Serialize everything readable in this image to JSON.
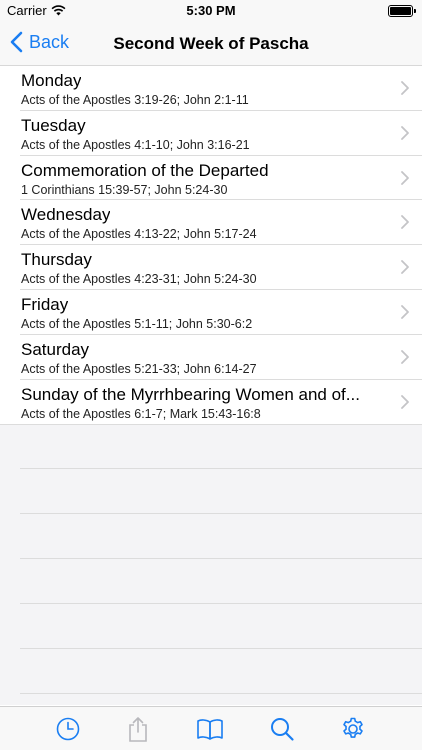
{
  "status_bar": {
    "carrier": "Carrier",
    "time": "5:30 PM",
    "wifi_icon": "wifi-icon",
    "battery_icon": "battery-icon"
  },
  "nav": {
    "back_label": "Back",
    "title": "Second Week of Pascha"
  },
  "accent_color": "#1a7ef2",
  "rows": [
    {
      "title": "Monday",
      "subtitle": "Acts of the Apostles 3:19-26; John 2:1-11"
    },
    {
      "title": "Tuesday",
      "subtitle": "Acts of the Apostles 4:1-10; John 3:16-21"
    },
    {
      "title": "Commemoration of the Departed",
      "subtitle": "1 Corinthians 15:39-57; John 5:24-30"
    },
    {
      "title": "Wednesday",
      "subtitle": "Acts of the Apostles 4:13-22; John 5:17-24"
    },
    {
      "title": "Thursday",
      "subtitle": "Acts of the Apostles 4:23-31; John 5:24-30"
    },
    {
      "title": "Friday",
      "subtitle": "Acts of the Apostles 5:1-11; John 5:30-6:2"
    },
    {
      "title": "Saturday",
      "subtitle": "Acts of the Apostles 5:21-33; John 6:14-27"
    },
    {
      "title": "Sunday of the Myrrhbearing Women and of...",
      "subtitle": "Acts of the Apostles 6:1-7; Mark 15:43-16:8"
    }
  ],
  "tab_bar": {
    "tabs": [
      "clock-icon",
      "share-icon",
      "book-icon",
      "search-icon",
      "gear-icon"
    ]
  }
}
